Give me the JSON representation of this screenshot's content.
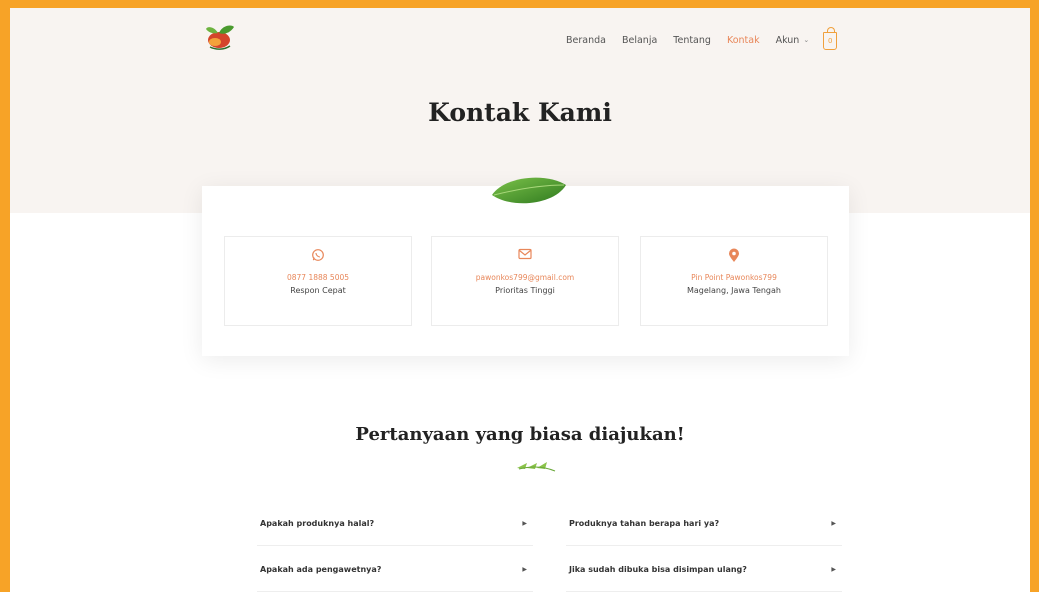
{
  "nav": {
    "items": [
      {
        "label": "Beranda",
        "active": false
      },
      {
        "label": "Belanja",
        "active": false
      },
      {
        "label": "Tentang",
        "active": false
      },
      {
        "label": "Kontak",
        "active": true
      }
    ],
    "account_label": "Akun",
    "cart_count": "0"
  },
  "page_title": "Kontak Kami",
  "contacts": [
    {
      "icon": "whatsapp-icon",
      "value": "0877 1888 5005",
      "caption": "Respon Cepat"
    },
    {
      "icon": "mail-icon",
      "value": "pawonkos799@gmail.com",
      "caption": "Prioritas Tinggi"
    },
    {
      "icon": "location-pin-icon",
      "value": "Pin Point Pawonkos799",
      "caption": "Magelang, Jawa Tengah"
    }
  ],
  "faq": {
    "title": "Pertanyaan yang biasa diajukan!",
    "items": [
      "Apakah produknya halal?",
      "Produknya tahan berapa hari ya?",
      "Apakah ada pengawetnya?",
      "Jika sudah dibuka bisa disimpan ulang?"
    ]
  },
  "colors": {
    "accent": "#e8875a",
    "cart": "#f0a03c",
    "hero_bg": "#f8f4f1",
    "border": "#f7a327"
  }
}
